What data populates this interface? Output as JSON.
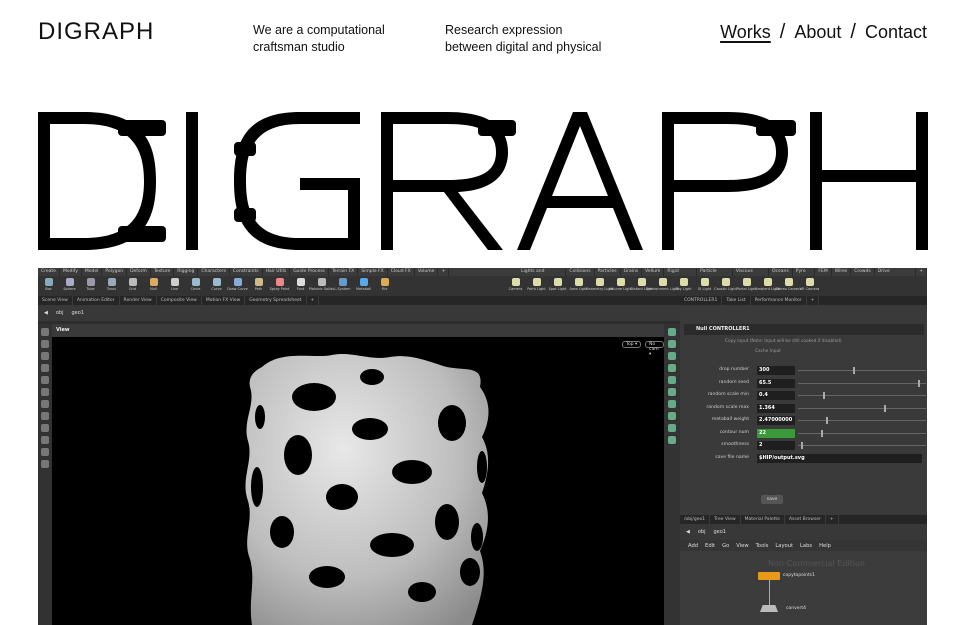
{
  "header": {
    "logo": "DIGRAPH",
    "tagline_1_line1": "We are a computational",
    "tagline_1_line2": "craftsman studio",
    "tagline_2_line1": "Research expression",
    "tagline_2_line2": "between digital and physical",
    "nav": [
      {
        "label": "Works",
        "active": true
      },
      {
        "label": "About",
        "active": false
      },
      {
        "label": "Contact",
        "active": false
      }
    ],
    "nav_separator": "/"
  },
  "hero": {
    "wordmark": "DIGRAPH"
  },
  "screenshot": {
    "menubar": [
      "Create",
      "Modify",
      "Model",
      "Polygon",
      "Deform",
      "Texture",
      "Rigging",
      "Characters",
      "Constraints",
      "Hair Utils",
      "Guide Process",
      "Terrain FX",
      "Simple FX",
      "Cloud FX",
      "Volume",
      "+"
    ],
    "menubar_right": [
      "Lights and Cameras",
      "Collisions",
      "Particles",
      "Grains",
      "Vellum",
      "Rigid Bodies",
      "Particle Fluids",
      "Viscous Fluids",
      "Oceans",
      "Pyro FX",
      "FEM",
      "Wires",
      "Crowds",
      "Drive Simulation",
      "+"
    ],
    "shelf_left": [
      "Box",
      "Sphere",
      "Tube",
      "Torus",
      "Grid",
      "Null",
      "Line",
      "Circle",
      "Curve",
      "Draw Curve",
      "Path",
      "Spray Paint",
      "Font",
      "Platonic Solids",
      "L-System",
      "Metaball",
      "File"
    ],
    "shelf_right": [
      "Camera",
      "Point Light",
      "Spot Light",
      "Area Light",
      "Geometry Light",
      "Volume Light",
      "Distant Light",
      "Environment Light",
      "Sky Light",
      "GI Light",
      "Caustic Light",
      "Portal Light",
      "Ambient Light",
      "Stereo Camera",
      "VR Camera"
    ],
    "pane_tabs": [
      "Scene View",
      "Animation Editor",
      "Render View",
      "Composite View",
      "Motion FX View",
      "Geometry Spreadsheet",
      "+"
    ],
    "pane_tabs_right": [
      "CONTROLLER1",
      "Take List",
      "Performance Monitor",
      "+"
    ],
    "path_obj": "obj",
    "path_geo": "geo1",
    "view_label": "View",
    "view_top": "Top ▾",
    "view_cam": "No cam ▾",
    "node_type": "Null",
    "node_name": "CONTROLLER1",
    "copy_input_note": "Copy Input (Note: Input will be still cooked if disabled)",
    "cache_input": "Cache Input",
    "params": [
      {
        "label": "drop number",
        "value": "300",
        "knob": 0.44
      },
      {
        "label": "random seed",
        "value": "65.5",
        "knob": 0.95
      },
      {
        "label": "random scale min",
        "value": "0.4",
        "knob": 0.2
      },
      {
        "label": "random scale max",
        "value": "1.364",
        "knob": 0.68
      },
      {
        "label": "metaball weight",
        "value": "2.47000000",
        "knob": 0.22
      },
      {
        "label": "contour num",
        "value": "22",
        "knob": 0.18
      },
      {
        "label": "smoothness",
        "value": "2",
        "knob": 0.02
      },
      {
        "label": "save file name",
        "value": "$HIP/output.svg"
      }
    ],
    "save_button": "save",
    "net_tabs": [
      "/obj/geo1",
      "Tree View",
      "Material Palette",
      "Asset Browser",
      "+"
    ],
    "net_menu": [
      "Add",
      "Edit",
      "Go",
      "View",
      "Tools",
      "Layout",
      "Labs",
      "Help"
    ],
    "net_watermark": "Non-Commercial Edition",
    "node_1": "copytopoints1",
    "node_2": "convert4",
    "colors": {
      "node_orange": "#e69a1a",
      "value_green": "#3a9a3a"
    }
  }
}
